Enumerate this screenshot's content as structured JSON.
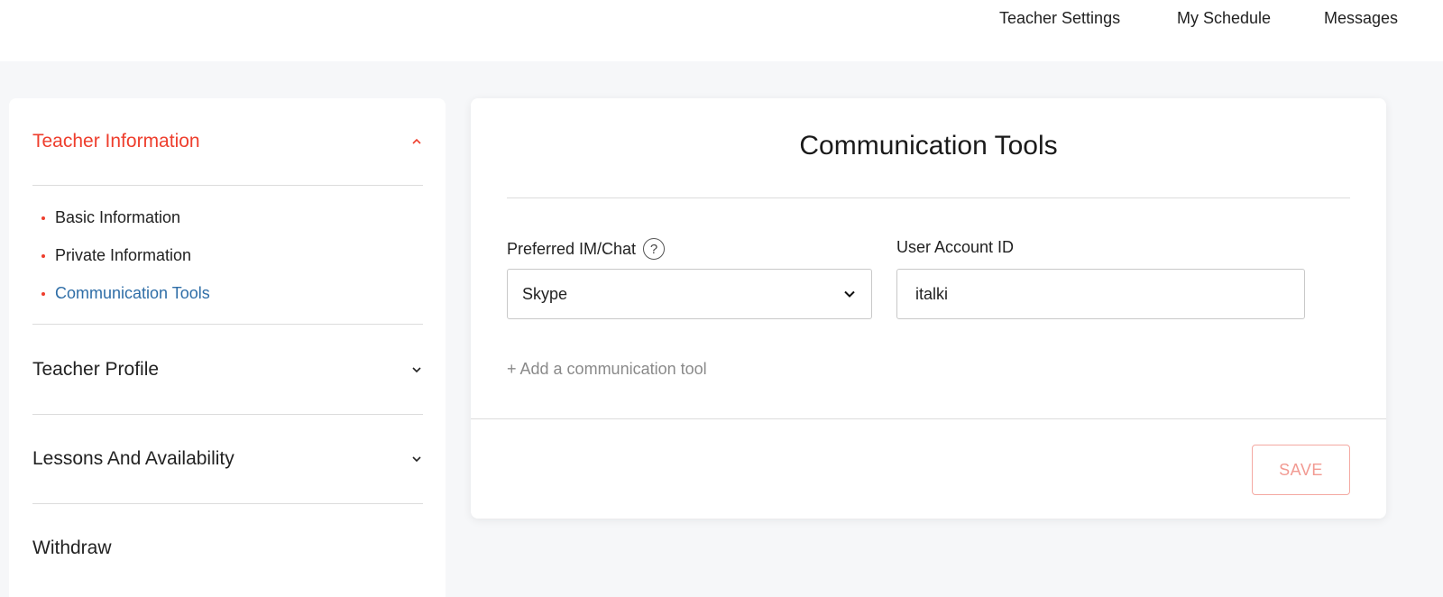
{
  "topnav": {
    "items": [
      {
        "label": "Teacher Settings"
      },
      {
        "label": "My Schedule"
      },
      {
        "label": "Messages"
      }
    ]
  },
  "sidebar": {
    "sections": [
      {
        "title": "Teacher Information",
        "expanded": true,
        "items": [
          {
            "label": "Basic Information",
            "active": false
          },
          {
            "label": "Private Information",
            "active": false
          },
          {
            "label": "Communication Tools",
            "active": true
          }
        ]
      },
      {
        "title": "Teacher Profile",
        "expanded": false
      },
      {
        "title": "Lessons And Availability",
        "expanded": false
      },
      {
        "title": "Withdraw",
        "expanded": false
      }
    ]
  },
  "main": {
    "title": "Communication Tools",
    "fields": {
      "im": {
        "label": "Preferred IM/Chat",
        "help_icon": "?",
        "value": "Skype"
      },
      "account": {
        "label": "User Account ID",
        "value": "italki"
      }
    },
    "add_tool_label": "+ Add a communication tool",
    "save_label": "SAVE"
  },
  "colors": {
    "accent": "#ee3e2d",
    "active_link": "#2f6ea7",
    "save_disabled": "#f29a92"
  }
}
